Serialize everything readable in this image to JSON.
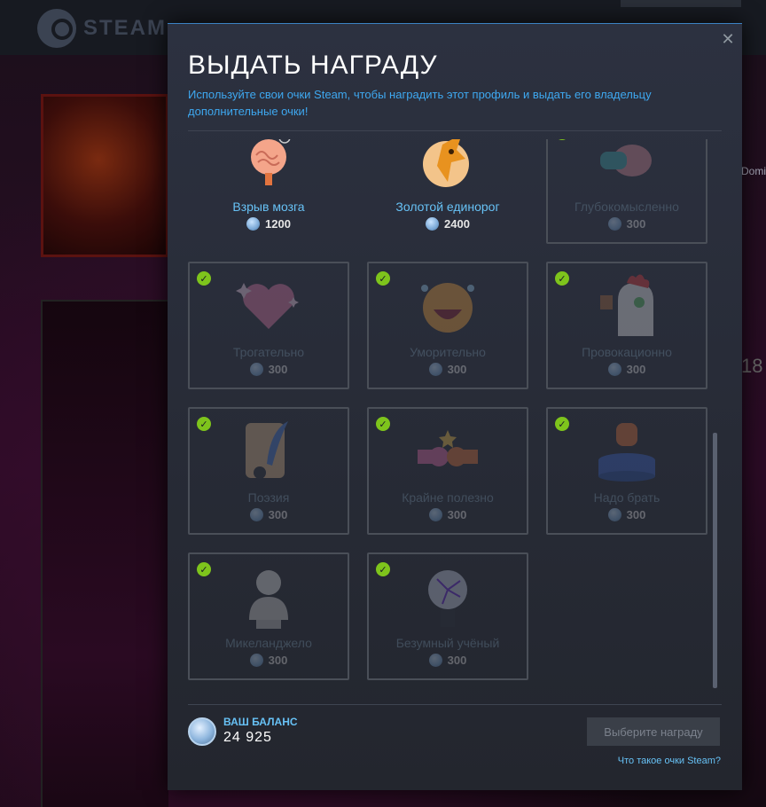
{
  "background": {
    "logo_text": "STEAM",
    "side_text_1": "Domi",
    "side_text_2": "18"
  },
  "modal": {
    "title": "ВЫДАТЬ НАГРАДУ",
    "subtitle": "Используйте свои очки Steam, чтобы наградить этот профиль и выдать его владельцу дополнительные очки!",
    "close_icon": "close-icon"
  },
  "rewards": [
    {
      "name": "Взрыв мозга",
      "price": "1200",
      "owned": false,
      "icon": "brain-explosion-icon"
    },
    {
      "name": "Золотой единорог",
      "price": "2400",
      "owned": false,
      "icon": "golden-unicorn-icon"
    },
    {
      "name": "Глубокомысленно",
      "price": "300",
      "owned": true,
      "icon": "deep-brain-icon"
    },
    {
      "name": "Трогательно",
      "price": "300",
      "owned": true,
      "icon": "heart-icon"
    },
    {
      "name": "Уморительно",
      "price": "300",
      "owned": true,
      "icon": "laughing-face-icon"
    },
    {
      "name": "Провокационно",
      "price": "300",
      "owned": true,
      "icon": "rooster-icon"
    },
    {
      "name": "Поэзия",
      "price": "300",
      "owned": true,
      "icon": "quill-scroll-icon"
    },
    {
      "name": "Крайне полезно",
      "price": "300",
      "owned": true,
      "icon": "fist-bump-icon"
    },
    {
      "name": "Надо брать",
      "price": "300",
      "owned": true,
      "icon": "glove-podium-icon"
    },
    {
      "name": "Микеланджело",
      "price": "300",
      "owned": true,
      "icon": "bust-statue-icon"
    },
    {
      "name": "Безумный учёный",
      "price": "300",
      "owned": true,
      "icon": "plasma-ball-icon"
    }
  ],
  "footer": {
    "balance_label": "ВАШ БАЛАНС",
    "balance_value": "24 925",
    "choose_button": "Выберите награду",
    "help_link": "Что такое очки Steam?"
  },
  "colors": {
    "accent": "#67c1f5",
    "subtitle": "#3ea8f0",
    "check": "#7ec41c"
  }
}
